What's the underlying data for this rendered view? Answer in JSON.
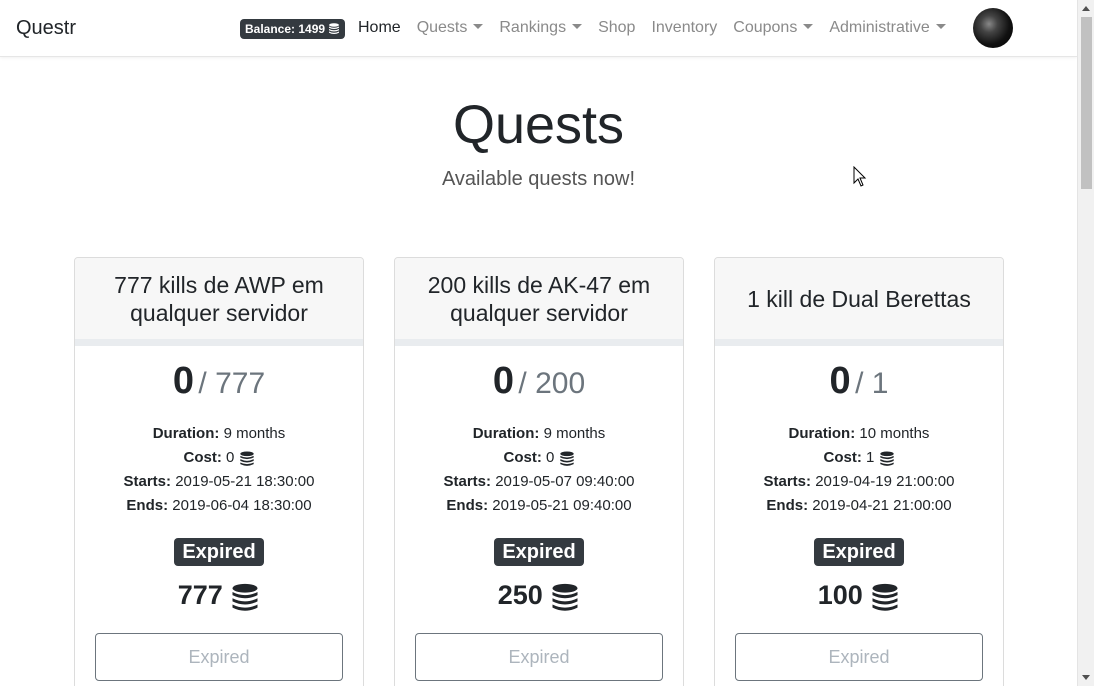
{
  "navbar": {
    "brand": "Questr",
    "balance": "Balance: 1499",
    "links": [
      {
        "label": "Home"
      },
      {
        "label": "Quests"
      },
      {
        "label": "Rankings"
      },
      {
        "label": "Shop"
      },
      {
        "label": "Inventory"
      },
      {
        "label": "Coupons"
      },
      {
        "label": "Administrative"
      }
    ]
  },
  "header": {
    "title": "Quests",
    "subtitle": "Available quests now!"
  },
  "labels": {
    "duration": "Duration:",
    "cost": "Cost:",
    "starts": "Starts:",
    "ends": "Ends:"
  },
  "quests": [
    {
      "title": "777 kills de AWP em qualquer servidor",
      "progress": "0",
      "goal": "/ 777",
      "duration": "9 months",
      "cost": "0",
      "starts": "2019-05-21 18:30:00",
      "ends": "2019-06-04 18:30:00",
      "status": "Expired",
      "reward": "777",
      "button": "Expired"
    },
    {
      "title": "200 kills de AK-47 em qualquer servidor",
      "progress": "0",
      "goal": "/ 200",
      "duration": "9 months",
      "cost": "0",
      "starts": "2019-05-07 09:40:00",
      "ends": "2019-05-21 09:40:00",
      "status": "Expired",
      "reward": "250",
      "button": "Expired"
    },
    {
      "title": "1 kill de Dual Berettas",
      "progress": "0",
      "goal": "/ 1",
      "duration": "10 months",
      "cost": "1",
      "starts": "2019-04-19 21:00:00",
      "ends": "2019-04-21 21:00:00",
      "status": "Expired",
      "reward": "100",
      "button": "Expired"
    }
  ],
  "colors": {
    "dark": "#343a40",
    "muted": "#6c757d",
    "card_header": "#f7f7f7"
  },
  "icons": {
    "coin": "coins-icon",
    "dropdown": "caret-down-icon"
  }
}
